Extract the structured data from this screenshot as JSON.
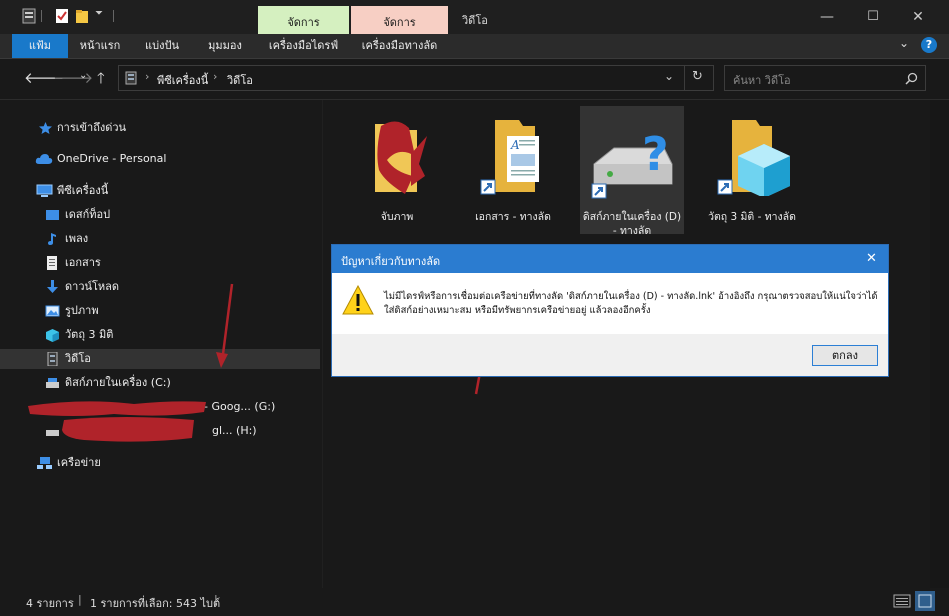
{
  "window": {
    "title": "วิดีโอ",
    "ribbon_context_tabs": [
      "จัดการ",
      "จัดการ"
    ],
    "controls": {
      "minimize": "—",
      "maximize": "☐",
      "close": "✕"
    }
  },
  "ribbon": {
    "tabs": [
      "แฟ้ม",
      "หน้าแรก",
      "แบ่งปัน",
      "มุมมอง",
      "เครื่องมือไดรฟ์",
      "เครื่องมือทางลัด"
    ],
    "help": "?",
    "collapse": "⌄"
  },
  "address": {
    "segments": [
      "พีซีเครื่องนี้",
      "วิดีโอ"
    ],
    "search_placeholder": "ค้นหา วิดีโอ"
  },
  "navpane": {
    "items": [
      {
        "label": "การเข้าถึงด่วน",
        "icon": "star-icon"
      },
      {
        "label": "OneDrive - Personal",
        "icon": "cloud-icon"
      },
      {
        "label": "พีซีเครื่องนี้",
        "icon": "computer-icon"
      },
      {
        "label": "เดสก์ท็อป",
        "icon": "desktop-icon"
      },
      {
        "label": "เพลง",
        "icon": "music-icon"
      },
      {
        "label": "เอกสาร",
        "icon": "document-icon"
      },
      {
        "label": "ดาวน์โหลด",
        "icon": "download-icon"
      },
      {
        "label": "รูปภาพ",
        "icon": "pictures-icon"
      },
      {
        "label": "วัตถุ 3 มิติ",
        "icon": "3d-objects-icon"
      },
      {
        "label": "วิดีโอ",
        "icon": "video-icon"
      },
      {
        "label": "ดิสก์ภายในเครื่อง (C:)",
        "icon": "drive-icon"
      },
      {
        "label": "- Goog... (G:)",
        "icon": "drive-icon"
      },
      {
        "label": "gl... (H:)",
        "icon": "drive-icon"
      },
      {
        "label": "เครือข่าย",
        "icon": "network-icon"
      }
    ]
  },
  "files": [
    {
      "label": "จับภาพ",
      "icon": "folder-icon"
    },
    {
      "label": "เอกสาร - ทางลัด",
      "icon": "document-shortcut-icon"
    },
    {
      "label": "ดิสก์ภายในเครื่อง (D) - ทางลัด",
      "icon": "broken-drive-shortcut-icon"
    },
    {
      "label": "วัตถุ 3 มิติ - ทางลัด",
      "icon": "3d-objects-shortcut-icon"
    }
  ],
  "status": {
    "item_count": "4 รายการ",
    "selection": "1 รายการที่เลือก: 543 ไบต์"
  },
  "dialog": {
    "title": "ปัญหาเกี่ยวกับทางลัด",
    "message": "ไม่มีไดรฟ์หรือการเชื่อมต่อเครือข่ายที่ทางลัด 'ดิสก์ภายในเครื่อง (D) - ทางลัด.lnk' อ้างอิงถึง กรุณาตรวจสอบให้แน่ใจว่าได้ใส่ดิสก์อย่างเหมาะสม หรือมีทรัพยากรเครือข่ายอยู่ แล้วลองอีกครั้ง",
    "ok_label": "ตกลง",
    "close": "✕"
  },
  "colors": {
    "accent": "#1979ca",
    "dialog_title": "#2b7cd0",
    "annotation": "#b0232a"
  }
}
